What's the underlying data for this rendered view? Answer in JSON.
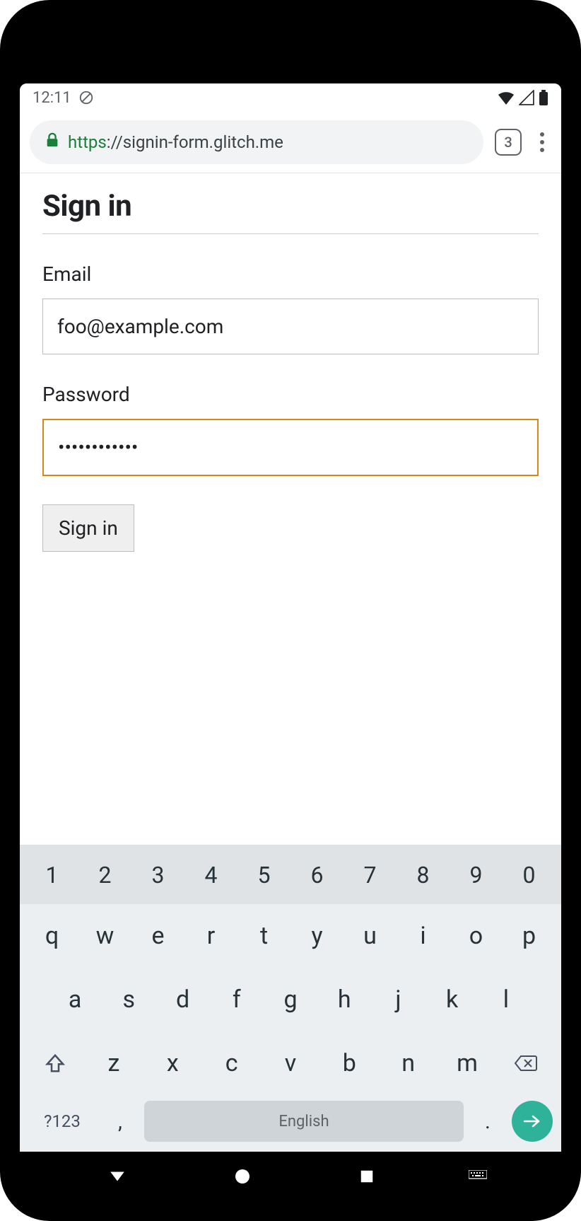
{
  "status_bar": {
    "time": "12:11"
  },
  "browser": {
    "url_scheme": "https",
    "url_sep": "://",
    "url_rest": "signin-form.glitch.me",
    "tab_count": "3"
  },
  "page": {
    "title": "Sign in",
    "email_label": "Email",
    "email_value": "foo@example.com",
    "password_label": "Password",
    "password_value": "••••••••••••",
    "submit_label": "Sign in"
  },
  "keyboard": {
    "numbers": [
      "1",
      "2",
      "3",
      "4",
      "5",
      "6",
      "7",
      "8",
      "9",
      "0"
    ],
    "row_q": [
      "q",
      "w",
      "e",
      "r",
      "t",
      "y",
      "u",
      "i",
      "o",
      "p"
    ],
    "row_a": [
      "a",
      "s",
      "d",
      "f",
      "g",
      "h",
      "j",
      "k",
      "l"
    ],
    "row_z": [
      "z",
      "x",
      "c",
      "v",
      "b",
      "n",
      "m"
    ],
    "switch_label": "?123",
    "comma": ",",
    "period": ".",
    "space_label": "English"
  }
}
